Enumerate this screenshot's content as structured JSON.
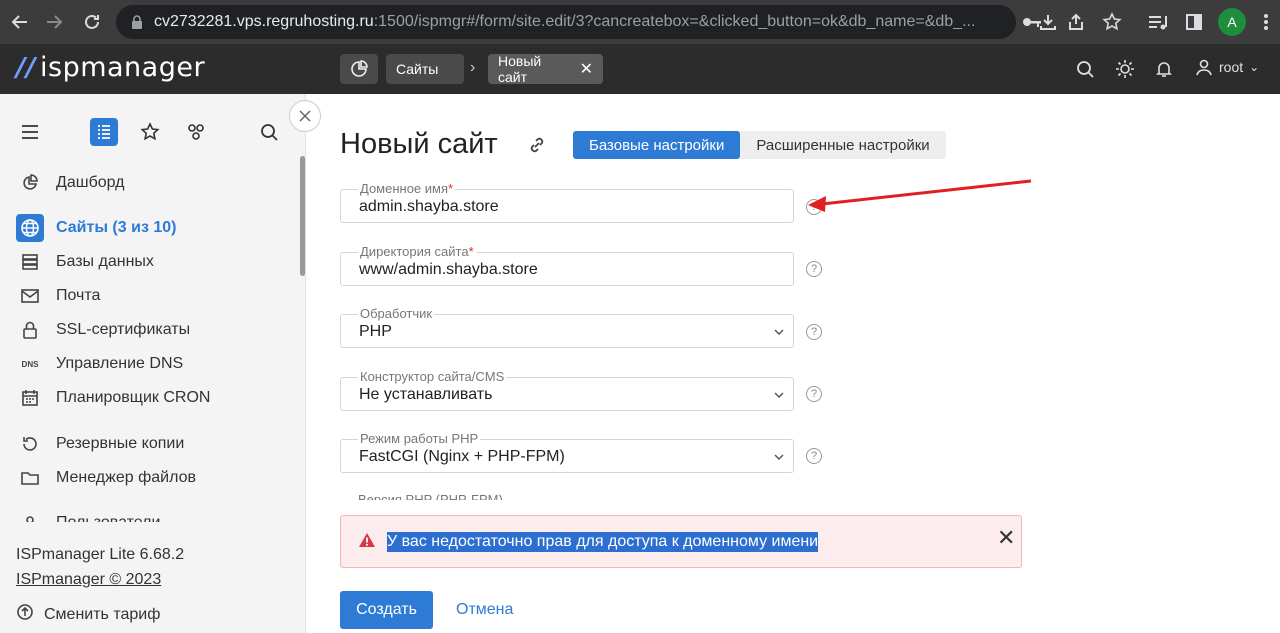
{
  "browser": {
    "url_host": "cv2732281.vps.regruhosting.ru",
    "url_rest": ":1500/ispmgr#/form/site.edit/3?cancreatebox=&clicked_button=ok&db_name=&db_...",
    "profile_initial": "A",
    "icons": [
      "back-icon",
      "forward-icon",
      "reload-icon",
      "site-info-icon",
      "key-icon",
      "download-icon",
      "share-icon",
      "star-icon",
      "media-icon",
      "sidepanel-icon",
      "menu-icon"
    ]
  },
  "header": {
    "logo_text": "ispmanager",
    "breadcrumbs": [
      "Сайты",
      "Новый сайт"
    ],
    "user": "root"
  },
  "sidebar": {
    "items": [
      {
        "label": "Дашборд",
        "icon": "dashboard-icon"
      },
      {
        "label": "Сайты (3 из 10)",
        "icon": "globe-icon"
      },
      {
        "label": "Базы данных",
        "icon": "database-icon"
      },
      {
        "label": "Почта",
        "icon": "mail-icon"
      },
      {
        "label": "SSL-сертификаты",
        "icon": "lock-icon"
      },
      {
        "label": "Управление DNS",
        "icon": "dns-icon"
      },
      {
        "label": "Планировщик CRON",
        "icon": "calendar-icon"
      },
      {
        "label": "Резервные копии",
        "icon": "backup-icon"
      },
      {
        "label": "Менеджер файлов",
        "icon": "folder-icon"
      },
      {
        "label": "Пользователи",
        "icon": "user-icon"
      }
    ],
    "version": "ISPmanager Lite 6.68.2",
    "copyright": "ISPmanager © 2023",
    "change_plan": "Сменить тариф"
  },
  "form": {
    "title": "Новый сайт",
    "tabs": [
      "Базовые настройки",
      "Расширенные настройки"
    ],
    "fields": [
      {
        "label": "Доменное имя",
        "required": "*",
        "value": "admin.shayba.store"
      },
      {
        "label": "Директория сайта",
        "required": "*",
        "value": "www/admin.shayba.store"
      },
      {
        "label": "Обработчик",
        "value": "PHP"
      },
      {
        "label": "Конструктор сайта/CMS",
        "value": "Не устанавливать"
      },
      {
        "label": "Режим работы PHP",
        "value": "FastCGI (Nginx + PHP-FPM)"
      }
    ],
    "cut_label": "Версия PHP (PHP-FPM)",
    "help_glyph": "?",
    "alert": "У вас недостаточно прав для доступа к доменному имени",
    "submit": "Создать",
    "cancel": "Отмена"
  },
  "colors": {
    "accent": "#2e7bd6",
    "alert_bg": "#fdecee",
    "annotation_arrow": "#e02020"
  }
}
